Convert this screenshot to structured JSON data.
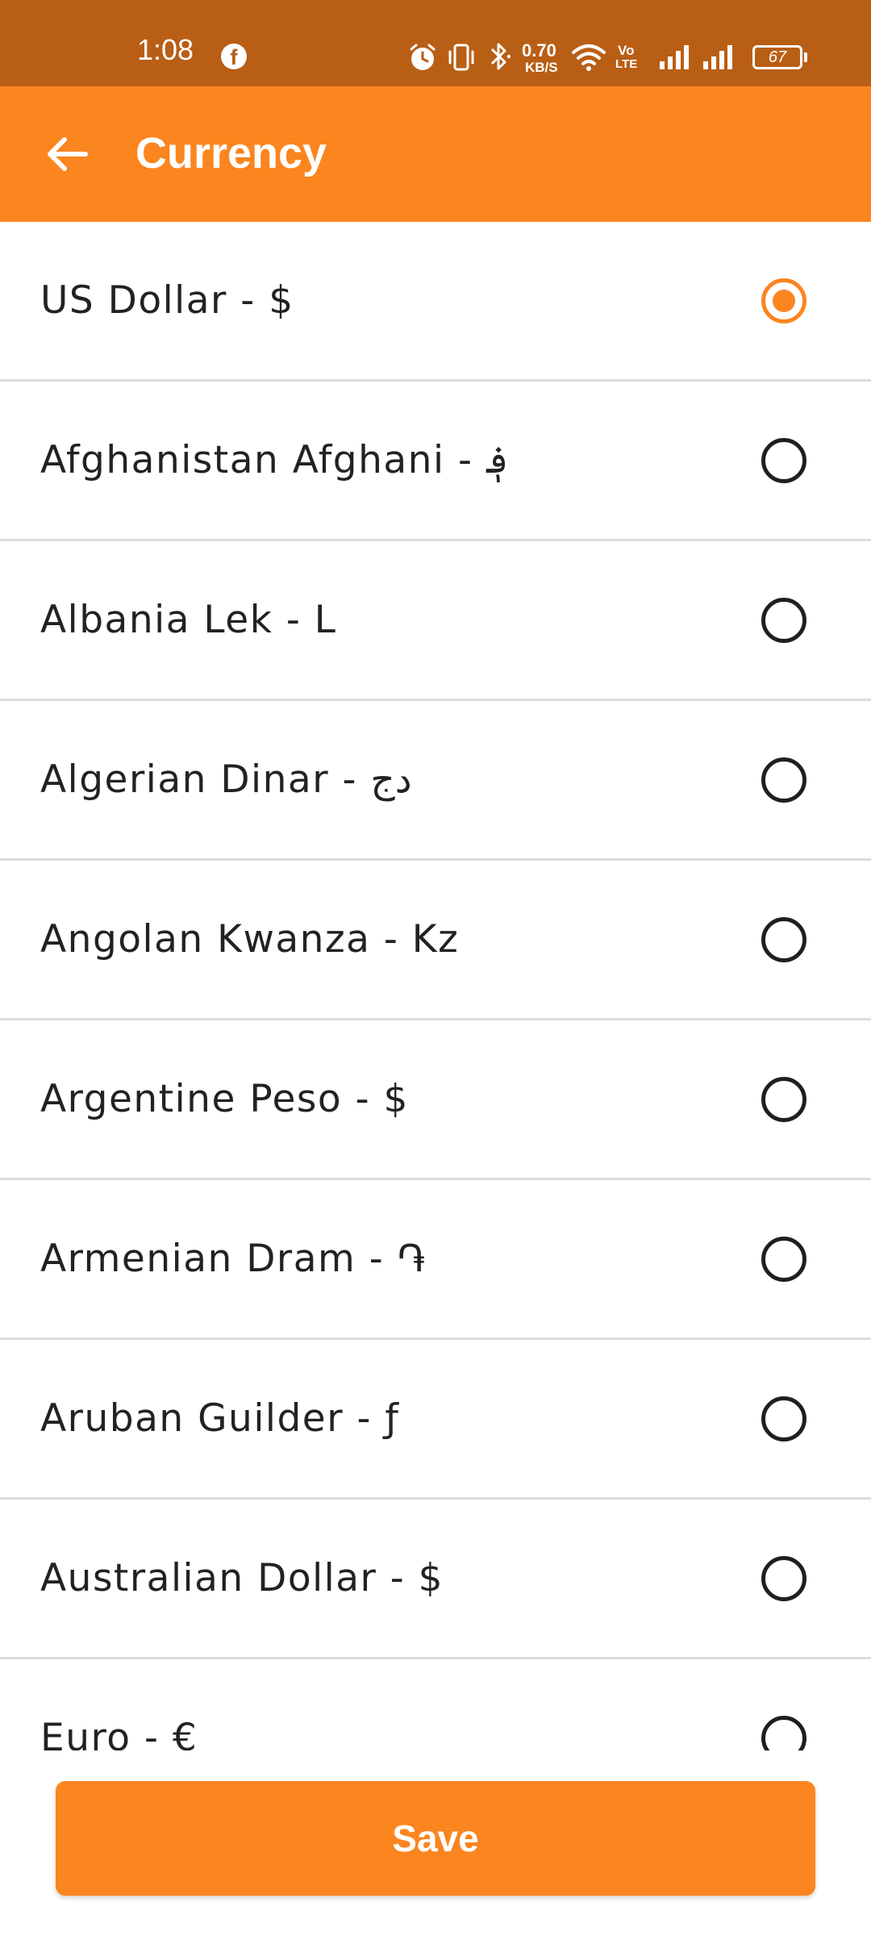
{
  "status_bar": {
    "time": "1:08",
    "network_speed_value": "0.70",
    "network_speed_unit": "KB/S",
    "volte_top": "Vo",
    "volte_bottom": "LTE",
    "battery": "67",
    "icons": [
      "facebook-icon",
      "alarm-icon",
      "vibrate-icon",
      "bluetooth-icon",
      "wifi-icon",
      "volte-icon",
      "signal-icon",
      "signal-icon",
      "battery-icon"
    ]
  },
  "app_bar": {
    "title": "Currency",
    "back_icon": "arrow-left-icon"
  },
  "currencies": [
    {
      "label": "US Dollar - $",
      "selected": true
    },
    {
      "label": "Afghanistan Afghani - ؋",
      "selected": false
    },
    {
      "label": "Albania Lek - L",
      "selected": false
    },
    {
      "label": "Algerian Dinar - دج",
      "selected": false
    },
    {
      "label": "Angolan Kwanza - Kz",
      "selected": false
    },
    {
      "label": "Argentine Peso - $",
      "selected": false
    },
    {
      "label": "Armenian Dram - ֏",
      "selected": false
    },
    {
      "label": "Aruban Guilder - ƒ",
      "selected": false
    },
    {
      "label": "Australian Dollar - $",
      "selected": false
    },
    {
      "label": "Euro - €",
      "selected": false
    }
  ],
  "save_button": {
    "label": "Save"
  },
  "colors": {
    "status_bar": "#b95e15",
    "accent": "#fb851f",
    "text": "#222222",
    "divider": "#dcdcdc"
  }
}
